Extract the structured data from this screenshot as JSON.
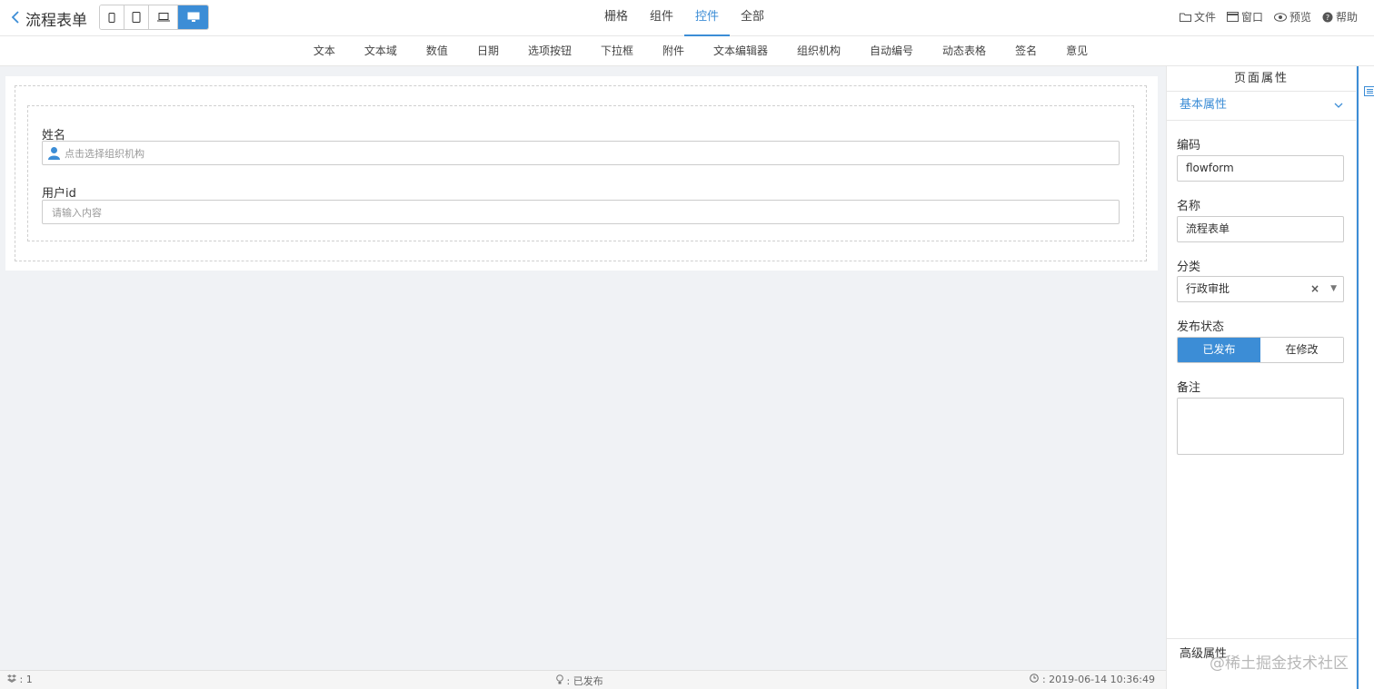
{
  "header": {
    "back_icon": "chevron-left-icon",
    "title": "流程表单",
    "devices": [
      "mobile-icon",
      "tablet-icon",
      "laptop-icon",
      "desktop-icon"
    ],
    "tabs": [
      {
        "label": "栅格"
      },
      {
        "label": "组件"
      },
      {
        "label": "控件",
        "active": true
      },
      {
        "label": "全部"
      }
    ],
    "menu": [
      {
        "icon": "folder-icon",
        "label": "文件"
      },
      {
        "icon": "window-icon",
        "label": "窗口"
      },
      {
        "icon": "eye-icon",
        "label": "预览"
      },
      {
        "icon": "help-icon",
        "label": "帮助"
      }
    ]
  },
  "controls": [
    "文本",
    "文本域",
    "数值",
    "日期",
    "选项按钮",
    "下拉框",
    "附件",
    "文本编辑器",
    "组织机构",
    "自动编号",
    "动态表格",
    "签名",
    "意见"
  ],
  "form": {
    "field1": {
      "label": "姓名",
      "placeholder": "点击选择组织机构",
      "icon": "user-icon"
    },
    "field2": {
      "label": "用户id",
      "placeholder": "请输入内容"
    }
  },
  "panel": {
    "title": "页面属性",
    "section": "基本属性",
    "code_label": "编码",
    "code_value": "flowform",
    "name_label": "名称",
    "name_value": "流程表单",
    "category_label": "分类",
    "category_value": "行政审批",
    "status_label": "发布状态",
    "status_options": [
      "已发布",
      "在修改"
    ],
    "status_selected": "已发布",
    "note_label": "备注",
    "advanced_label": "高级属性"
  },
  "status_bar": {
    "left": ": 1",
    "middle": ": 已发布",
    "right": ": 2019-06-14 10:36:49"
  },
  "watermark": "@稀土掘金技术社区",
  "colors": {
    "accent": "#3c8dd6",
    "background": "#f0f2f5"
  }
}
